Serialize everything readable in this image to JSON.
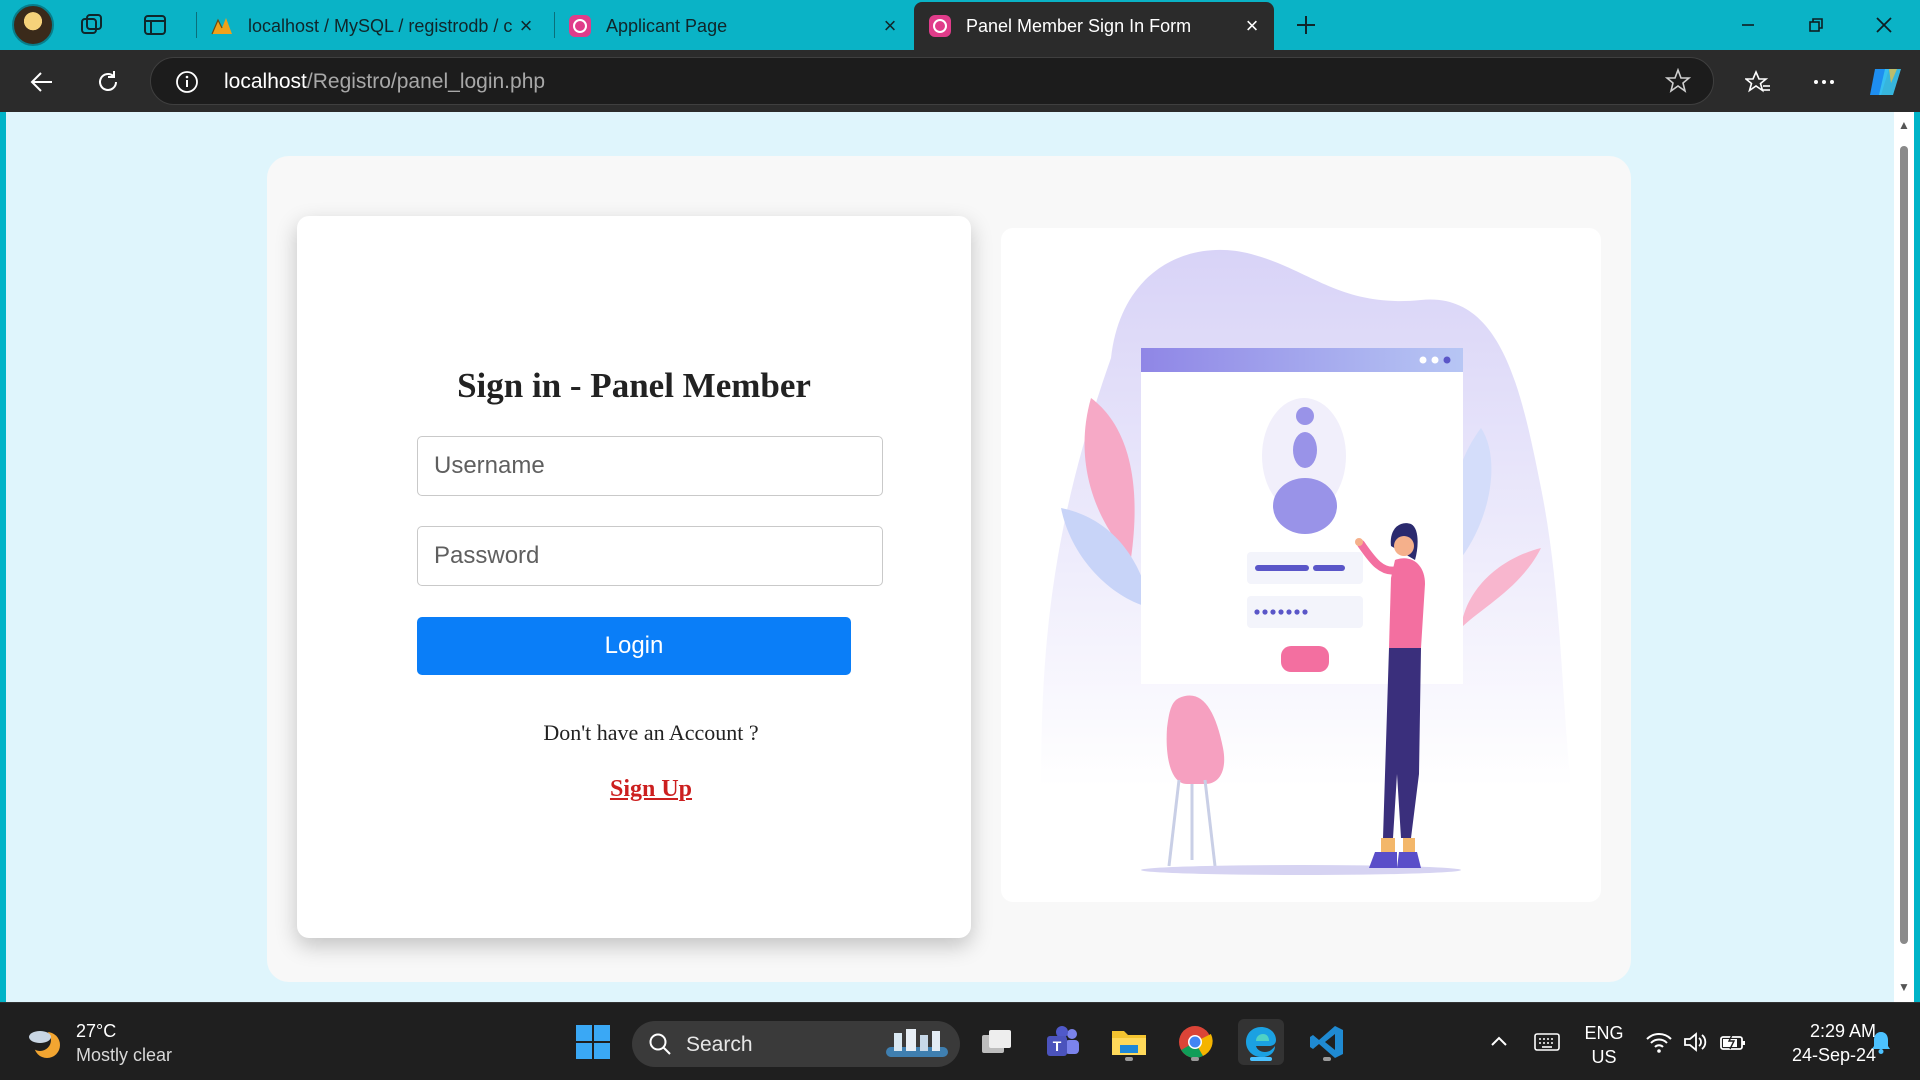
{
  "browser": {
    "tabs": [
      {
        "title": "localhost / MySQL / registrodb / c",
        "active": false
      },
      {
        "title": "Applicant Page",
        "active": false
      },
      {
        "title": "Panel Member Sign In Form",
        "active": true
      }
    ],
    "address": {
      "host": "localhost",
      "path": "/Registro/panel_login.php"
    }
  },
  "page": {
    "form": {
      "title": "Sign in - Panel Member",
      "username_placeholder": "Username",
      "password_placeholder": "Password",
      "login_label": "Login",
      "no_account_text": "Don't have an Account ?",
      "signup_label": "Sign Up"
    }
  },
  "taskbar": {
    "weather": {
      "temp": "27°C",
      "desc": "Mostly clear"
    },
    "search_label": "Search",
    "lang_line1": "ENG",
    "lang_line2": "US",
    "time": "2:29 AM",
    "date": "24-Sep-24"
  },
  "colors": {
    "tabbar": "#0ab3c6",
    "page_bg": "#dff5fc",
    "login_button": "#0a7ef8",
    "signup_link": "#cc1f1f",
    "accent_purple": "#8f86e6",
    "accent_pink": "#f36fa0"
  }
}
